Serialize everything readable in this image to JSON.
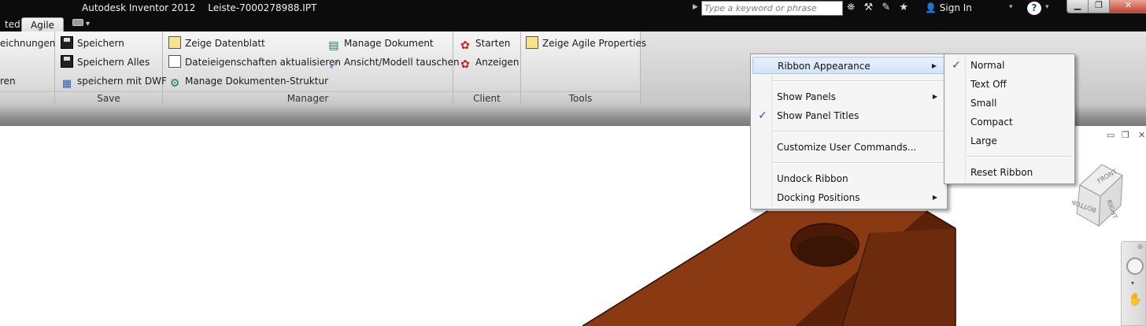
{
  "title_bar": {
    "app_name": "Autodesk Inventor 2012",
    "file_name": "Leiste-7000278988.IPT",
    "search_placeholder": "Type a keyword or phrase",
    "sign_in": "Sign In",
    "help": "?"
  },
  "tabs": [
    {
      "label": "ted"
    },
    {
      "label": "Agile",
      "active": true
    }
  ],
  "ribbon": {
    "left_partial": {
      "items": [
        "eichnungen",
        "ren"
      ]
    },
    "panels": [
      {
        "title": "Save",
        "items": [
          "Speichern",
          "Speichern Alles",
          "speichern mit DWF"
        ]
      },
      {
        "title": "Manager",
        "items": [
          "Zeige Datenblatt",
          "Dateieigenschaften aktualisieren",
          "Manage Dokumenten-Struktur",
          "Manage Dokument",
          "Ansicht/Modell tauschen"
        ]
      },
      {
        "title": "Client",
        "items": [
          "Starten",
          "Anzeigen"
        ]
      },
      {
        "title": "Tools",
        "items": [
          "Zeige Agile Properties"
        ]
      }
    ]
  },
  "context_menu": {
    "items": [
      {
        "label": "Ribbon Appearance",
        "submenu": true,
        "highlighted": true
      },
      {
        "label": "Show Panels",
        "submenu": true
      },
      {
        "label": "Show Panel Titles",
        "checked": true
      },
      {
        "label": "Customize User Commands..."
      },
      {
        "label": "Undock Ribbon"
      },
      {
        "label": "Docking Positions",
        "submenu": true
      }
    ]
  },
  "submenu": {
    "items": [
      {
        "label": "Normal",
        "checked": true
      },
      {
        "label": "Text Off"
      },
      {
        "label": "Small"
      },
      {
        "label": "Compact"
      },
      {
        "label": "Large"
      },
      {
        "label": "Reset Ribbon"
      }
    ]
  },
  "viewcube": {
    "faces": [
      "FRONT",
      "RIGHT",
      "BOTTOM"
    ]
  },
  "colors": {
    "model_top": "#8a3a12",
    "model_front": "#6e2c0c",
    "model_right": "#4e1e08",
    "accent_check": "#2254b4"
  }
}
